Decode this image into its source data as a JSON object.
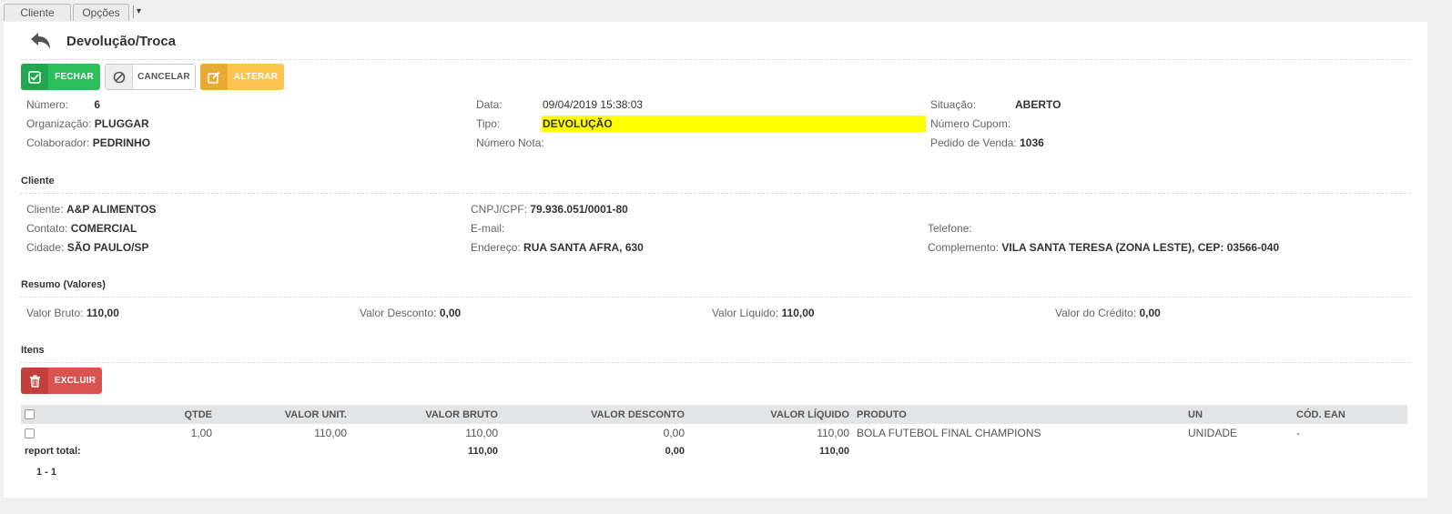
{
  "tabs": [
    {
      "label": "Cliente"
    },
    {
      "label": "Opções"
    }
  ],
  "tab_dropdown_icon": "▾",
  "header": {
    "title": "Devolução/Troca",
    "back_icon": "reply-arrow-icon"
  },
  "toolbar": {
    "close_label": "FECHAR",
    "cancel_label": "CANCELAR",
    "edit_label": "ALTERAR"
  },
  "info": {
    "numero": {
      "label": "Número:",
      "value": "6"
    },
    "organizacao": {
      "label": "Organização:",
      "value": "PLUGGAR"
    },
    "colaborador": {
      "label": "Colaborador:",
      "value": "PEDRINHO"
    },
    "data": {
      "label": "Data:",
      "value": "09/04/2019 15:38:03"
    },
    "tipo": {
      "label": "Tipo:",
      "value": "DEVOLUÇÃO"
    },
    "numero_nota": {
      "label": "Número Nota:",
      "value": ""
    },
    "situacao": {
      "label": "Situação:",
      "value": "ABERTO"
    },
    "numero_cupom": {
      "label": "Número Cupom:",
      "value": ""
    },
    "pedido_venda": {
      "label": "Pedido de Venda:",
      "value": "1036"
    }
  },
  "cliente_section": {
    "title": "Cliente",
    "cliente": {
      "label": "Cliente:",
      "value": "A&P ALIMENTOS"
    },
    "contato": {
      "label": "Contato:",
      "value": "COMERCIAL"
    },
    "cidade": {
      "label": "Cidade:",
      "value": "SÃO PAULO/SP"
    },
    "cnpj": {
      "label": "CNPJ/CPF:",
      "value": "79.936.051/0001-80"
    },
    "email": {
      "label": "E-mail:",
      "value": ""
    },
    "endereco": {
      "label": "Endereço:",
      "value": "RUA SANTA AFRA, 630"
    },
    "telefone": {
      "label": "Telefone:",
      "value": ""
    },
    "complemento": {
      "label": "Complemento:",
      "value": "VILA SANTA TERESA (ZONA LESTE), CEP: 03566-040"
    }
  },
  "resumo": {
    "title": "Resumo (Valores)",
    "valor_bruto": {
      "label": "Valor Bruto:",
      "value": "110,00"
    },
    "valor_desconto": {
      "label": "Valor Desconto:",
      "value": "0,00"
    },
    "valor_liquido": {
      "label": "Valor Líquido:",
      "value": "110,00"
    },
    "valor_credito": {
      "label": "Valor do Crédito:",
      "value": "0,00"
    }
  },
  "itens": {
    "title": "Itens",
    "delete_label": "EXCLUIR",
    "columns": [
      "QTDE",
      "VALOR UNIT.",
      "VALOR BRUTO",
      "VALOR DESCONTO",
      "VALOR LÍQUIDO",
      "PRODUTO",
      "UN",
      "CÓD. EAN"
    ],
    "rows": [
      {
        "qtde": "1,00",
        "valor_unit": "110,00",
        "valor_bruto": "110,00",
        "valor_desconto": "0,00",
        "valor_liquido": "110,00",
        "produto": "BOLA FUTEBOL FINAL CHAMPIONS",
        "un": "UNIDADE",
        "ean": "-"
      }
    ],
    "total": {
      "label": "report total:",
      "valor_bruto": "110,00",
      "valor_desconto": "0,00",
      "valor_liquido": "110,00"
    },
    "pager": "1 - 1"
  },
  "colors": {
    "highlight": "#ffff00",
    "green": "#2bbf5c",
    "yellow": "#fcc34f",
    "red": "#d9534f"
  }
}
